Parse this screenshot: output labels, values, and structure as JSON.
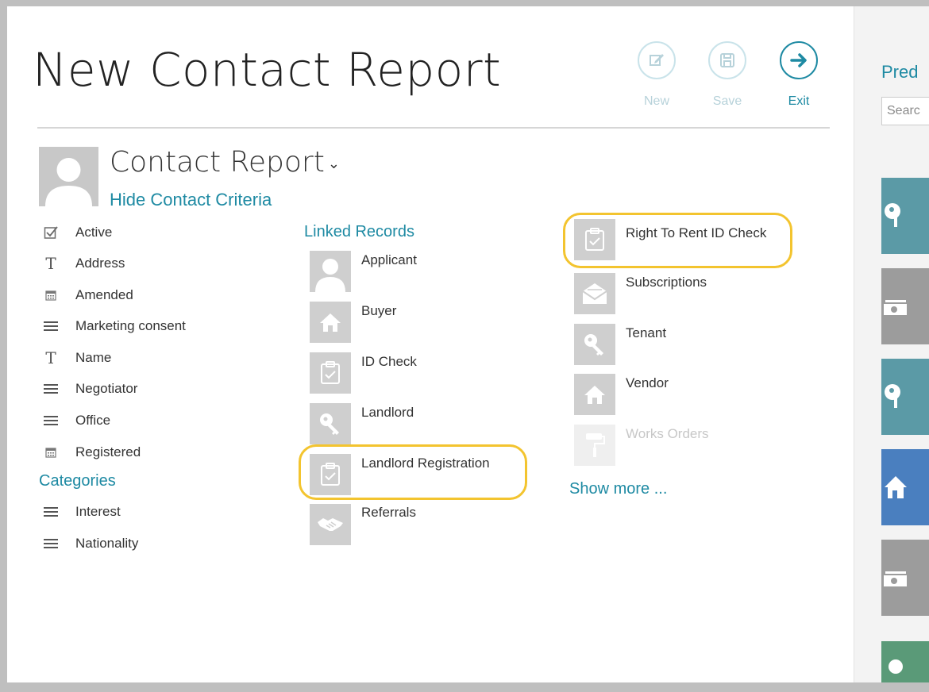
{
  "page": {
    "title": "New Contact Report"
  },
  "toolbar": [
    {
      "label": "New",
      "icon": "new-edit-icon",
      "enabled": false
    },
    {
      "label": "Save",
      "icon": "save-icon",
      "enabled": false
    },
    {
      "label": "Exit",
      "icon": "exit-arrow-icon",
      "enabled": true
    }
  ],
  "report": {
    "type_label": "Contact Report",
    "toggle_link": "Hide Contact Criteria"
  },
  "criteria": [
    {
      "label": "Active",
      "icon": "checkbox-icon"
    },
    {
      "label": "Address",
      "icon": "text-icon"
    },
    {
      "label": "Amended",
      "icon": "calendar-icon"
    },
    {
      "label": "Marketing consent",
      "icon": "list-icon"
    },
    {
      "label": "Name",
      "icon": "text-icon"
    },
    {
      "label": "Negotiator",
      "icon": "list-icon"
    },
    {
      "label": "Office",
      "icon": "list-icon"
    },
    {
      "label": "Registered",
      "icon": "calendar-icon"
    }
  ],
  "categories": {
    "heading": "Categories",
    "items": [
      {
        "label": "Interest",
        "icon": "list-icon"
      },
      {
        "label": "Nationality",
        "icon": "list-icon"
      }
    ]
  },
  "linked_records": {
    "heading": "Linked Records",
    "col1": [
      {
        "label": "Applicant",
        "icon": "person-icon"
      },
      {
        "label": "Buyer",
        "icon": "house-icon"
      },
      {
        "label": "ID Check",
        "icon": "clipboard-check-icon"
      },
      {
        "label": "Landlord",
        "icon": "key-icon"
      },
      {
        "label": "Landlord Registration",
        "icon": "clipboard-check-icon",
        "highlighted": true
      },
      {
        "label": "Referrals",
        "icon": "handshake-icon"
      }
    ],
    "col2": [
      {
        "label": "Right To Rent ID Check",
        "icon": "clipboard-check-icon",
        "highlighted": true
      },
      {
        "label": "Subscriptions",
        "icon": "envelope-icon"
      },
      {
        "label": "Tenant",
        "icon": "key-icon"
      },
      {
        "label": "Vendor",
        "icon": "house-icon"
      },
      {
        "label": "Works Orders",
        "icon": "paint-roller-icon",
        "disabled": true
      }
    ],
    "show_more": "Show more ..."
  },
  "right_panel": {
    "title": "Pred",
    "search_placeholder": "Searc",
    "tile_colors": [
      "#5b9aa6",
      "#9c9c9c",
      "#5b9aa6",
      "#4a7fbf",
      "#9c9c9c",
      "#5a9a78"
    ]
  },
  "colors": {
    "accent": "#1e8aa3",
    "highlight": "#f3c42f",
    "icon_tile": "#cfcfcf"
  }
}
